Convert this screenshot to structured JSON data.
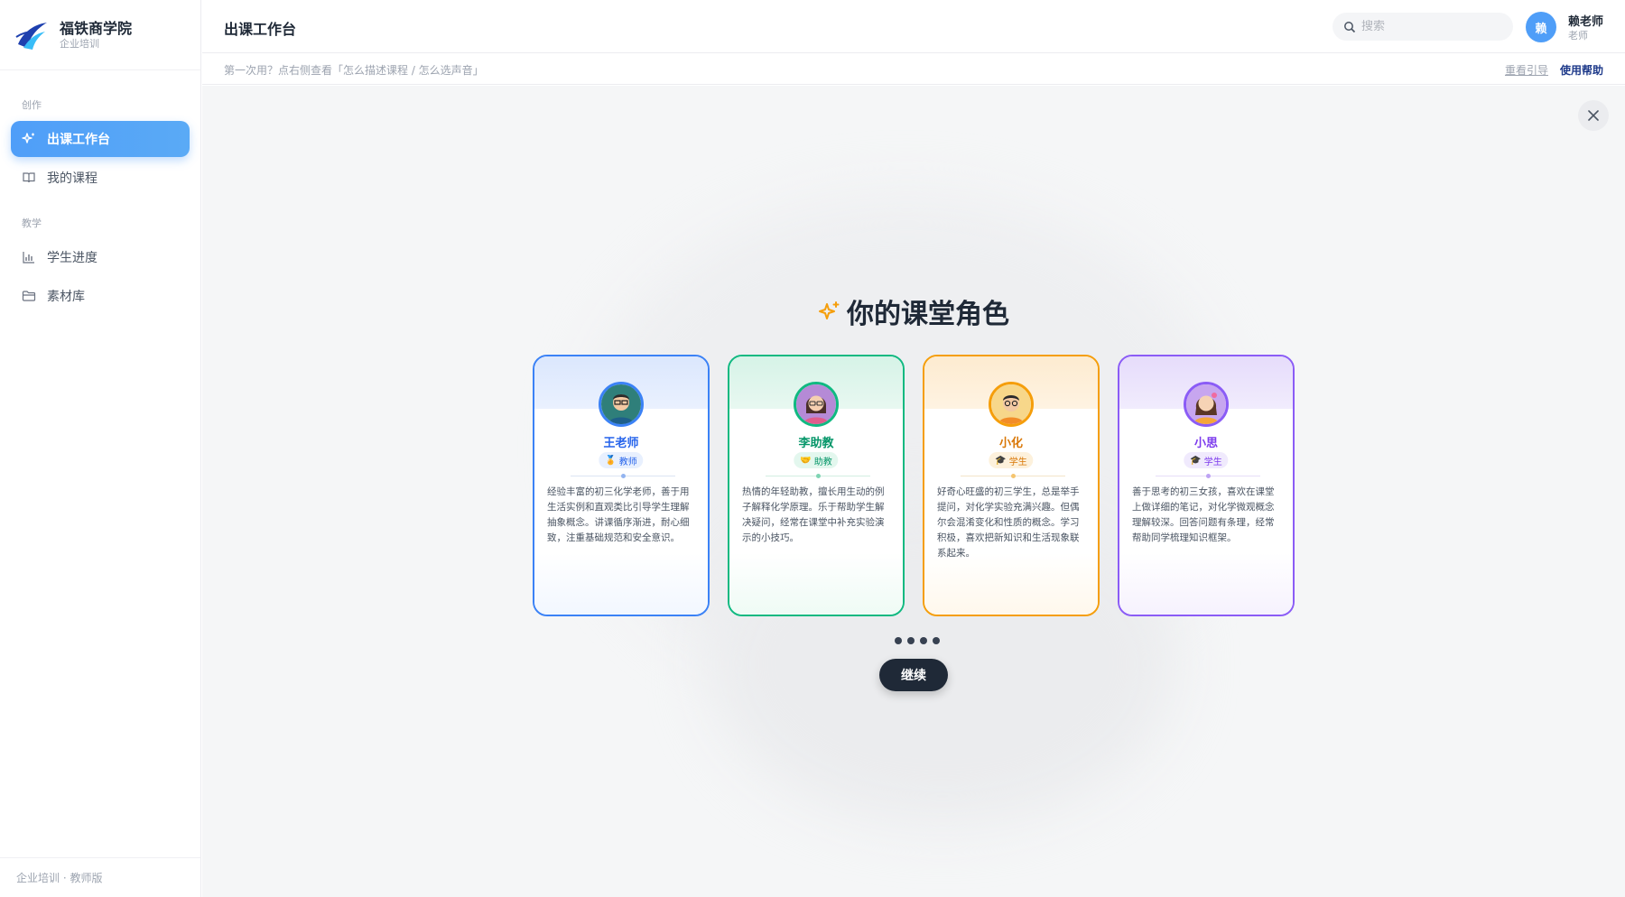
{
  "brand": {
    "name": "福铁商学院",
    "subtitle": "企业培训"
  },
  "sidebar": {
    "sections": [
      {
        "label": "创作"
      },
      {
        "label": "教学"
      }
    ],
    "items": [
      {
        "label": "出课工作台",
        "icon": "sparkle-icon",
        "active": true
      },
      {
        "label": "我的课程",
        "icon": "book-icon",
        "active": false
      },
      {
        "label": "学生进度",
        "icon": "bar-chart-icon",
        "active": false
      },
      {
        "label": "素材库",
        "icon": "folder-icon",
        "active": false
      }
    ],
    "footer": "企业培训 · 教师版"
  },
  "header": {
    "title": "出课工作台",
    "search_placeholder": "搜索",
    "user": {
      "avatar_initial": "赖",
      "name": "赖老师",
      "role": "老师"
    }
  },
  "tipbar": {
    "text": "第一次用？点右侧查看「怎么描述课程 / 怎么选声音」",
    "replay_label": "重看引导",
    "help_label": "使用帮助"
  },
  "modal": {
    "title": "你的课堂角色",
    "continue_label": "继续",
    "pages": 4,
    "cards": [
      {
        "name": "王老师",
        "badge": "教师",
        "badge_icon": "🏅",
        "color": "#3b82f6",
        "desc": "经验丰富的初三化学老师，善于用生活实例和直观类比引导学生理解抽象概念。讲课循序渐进，耐心细致，注重基础规范和安全意识。"
      },
      {
        "name": "李助教",
        "badge": "助教",
        "badge_icon": "🤝",
        "color": "#10b981",
        "desc": "热情的年轻助教，擅长用生动的例子解释化学原理。乐于帮助学生解决疑问，经常在课堂中补充实验演示的小技巧。"
      },
      {
        "name": "小化",
        "badge": "学生",
        "badge_icon": "🎓",
        "color": "#f59e0b",
        "desc": "好奇心旺盛的初三学生，总是举手提问，对化学实验充满兴趣。但偶尔会混淆变化和性质的概念。学习积极，喜欢把新知识和生活现象联系起来。"
      },
      {
        "name": "小思",
        "badge": "学生",
        "badge_icon": "🎓",
        "color": "#8b5cf6",
        "desc": "善于思考的初三女孩，喜欢在课堂上做详细的笔记，对化学微观概念理解较深。回答问题有条理，经常帮助同学梳理知识框架。"
      }
    ]
  }
}
